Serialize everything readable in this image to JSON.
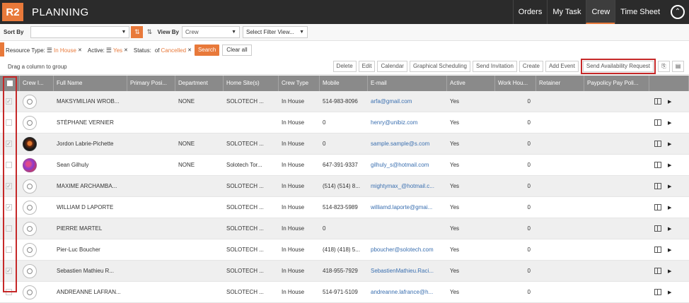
{
  "app": {
    "logo": "R2",
    "title": "PLANNING"
  },
  "nav": {
    "items": [
      "Orders",
      "My Task",
      "Crew",
      "Time Sheet"
    ],
    "active": "Crew"
  },
  "toolbar": {
    "sort_by_label": "Sort By",
    "sort_by_value": "",
    "view_by_label": "View By",
    "view_by_value": "Crew",
    "filter_placeholder": "Select Filter View..."
  },
  "filters": {
    "resource_type_label": "Resource Type:",
    "resource_type_value": "In House",
    "active_label": "Active:",
    "active_value": "Yes",
    "status_label": "Status:",
    "status_prefix": "of",
    "status_value": "Cancelled",
    "search_label": "Search",
    "clear_label": "Clear all"
  },
  "grid": {
    "drag_hint": "Drag a column to group",
    "actions": [
      "Delete",
      "Edit",
      "Calendar",
      "Graphical Scheduling",
      "Send Invitation",
      "Create",
      "Add Event",
      "Send Availability Request"
    ],
    "columns": [
      "",
      "Crew I...",
      "Full Name",
      "Primary Posi...",
      "Department",
      "Home Site(s)",
      "Crew Type",
      "Mobile",
      "E-mail",
      "Active",
      "Work Hou...",
      "Retainer",
      "Paypolicy Pay Poli...",
      ""
    ],
    "rows": [
      {
        "checked": true,
        "avatar": "default",
        "name": "MAKSYMILIAN WROB...",
        "dept": "NONE",
        "site": "SOLOTECH ...",
        "type": "In House",
        "mobile": "514-983-8096",
        "email": "arfa@gmail.com",
        "active": "Yes",
        "hours": "0"
      },
      {
        "checked": false,
        "avatar": "default",
        "name": "STÉPHANE VERNIER",
        "dept": "",
        "site": "",
        "type": "In House",
        "mobile": "0",
        "email": "henry@unibiz.com",
        "active": "Yes",
        "hours": "0"
      },
      {
        "checked": true,
        "avatar": "photo1",
        "name": "Jordon Labrie-Pichette",
        "dept": "NONE",
        "site": "SOLOTECH ...",
        "type": "In House",
        "mobile": "0",
        "email": "sample.sample@s.com",
        "active": "Yes",
        "hours": "0"
      },
      {
        "checked": false,
        "avatar": "photo2",
        "name": "Sean Gilhuly",
        "dept": "NONE",
        "site": "Solotech Tor...",
        "type": "In House",
        "mobile": "647-391-9337",
        "email": "gilhuly_s@hotmail.com",
        "active": "Yes",
        "hours": "0"
      },
      {
        "checked": true,
        "avatar": "default",
        "name": "MAXIME ARCHAMBA...",
        "dept": "",
        "site": "SOLOTECH ...",
        "type": "In House",
        "mobile": "(514) (514) 8...",
        "email": "mightymax_@hotmail.c...",
        "active": "Yes",
        "hours": "0"
      },
      {
        "checked": true,
        "avatar": "default",
        "name": "WILLIAM D LAPORTE",
        "dept": "",
        "site": "SOLOTECH ...",
        "type": "In House",
        "mobile": "514-823-5989",
        "email": "williamd.laporte@gmai...",
        "active": "Yes",
        "hours": "0"
      },
      {
        "checked": false,
        "avatar": "default",
        "name": "PIERRE MARTEL",
        "dept": "",
        "site": "SOLOTECH ...",
        "type": "In House",
        "mobile": "0",
        "email": "",
        "active": "Yes",
        "hours": "0"
      },
      {
        "checked": false,
        "avatar": "default",
        "name": "Pier-Luc Boucher",
        "dept": "",
        "site": "SOLOTECH ...",
        "type": "In House",
        "mobile": "(418) (418) 5...",
        "email": "pboucher@solotech.com",
        "active": "Yes",
        "hours": "0"
      },
      {
        "checked": true,
        "avatar": "default",
        "name": "Sebastien Mathieu R...",
        "dept": "",
        "site": "SOLOTECH ...",
        "type": "In House",
        "mobile": "418-955-7929",
        "email": "SebastienMathieu.Raci...",
        "active": "Yes",
        "hours": "0"
      },
      {
        "checked": false,
        "avatar": "default",
        "name": "ANDREANNE LAFRAN...",
        "dept": "",
        "site": "SOLOTECH ...",
        "type": "In House",
        "mobile": "514-971-5109",
        "email": "andreanne.lafrance@h...",
        "active": "Yes",
        "hours": "0"
      }
    ]
  }
}
